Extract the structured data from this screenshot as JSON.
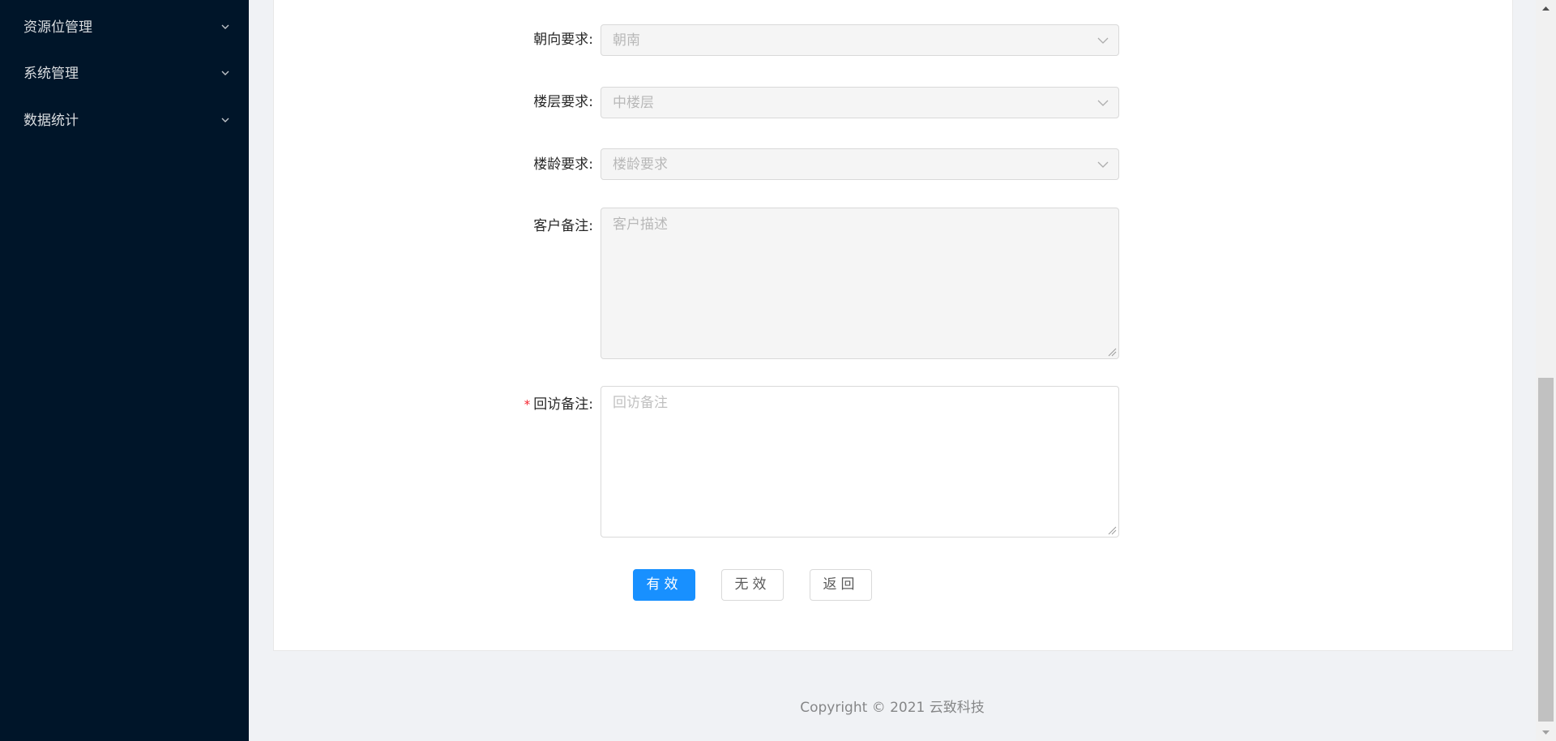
{
  "sidebar": {
    "items": [
      {
        "label": "资源位管理",
        "icon": "chevron-down-icon"
      },
      {
        "label": "系统管理",
        "icon": "chevron-down-icon"
      },
      {
        "label": "数据统计",
        "icon": "chevron-down-icon"
      }
    ]
  },
  "form": {
    "orientation": {
      "label": "朝向要求:",
      "value": "朝南"
    },
    "floor": {
      "label": "楼层要求:",
      "value": "中楼层"
    },
    "building_age": {
      "label": "楼龄要求:",
      "placeholder": "楼龄要求"
    },
    "customer_note": {
      "label": "客户备注:",
      "placeholder": "客户描述"
    },
    "visit_note": {
      "required_mark": "*",
      "label": "回访备注:",
      "placeholder": "回访备注"
    }
  },
  "actions": {
    "valid_label": "有效",
    "invalid_label": "无效",
    "back_label": "返回"
  },
  "footer": {
    "text": "Copyright © 2021 云致科技"
  },
  "colors": {
    "sidebar_bg": "#001529",
    "primary": "#1890ff",
    "required": "#f5222d",
    "page_bg": "#f0f2f5"
  }
}
